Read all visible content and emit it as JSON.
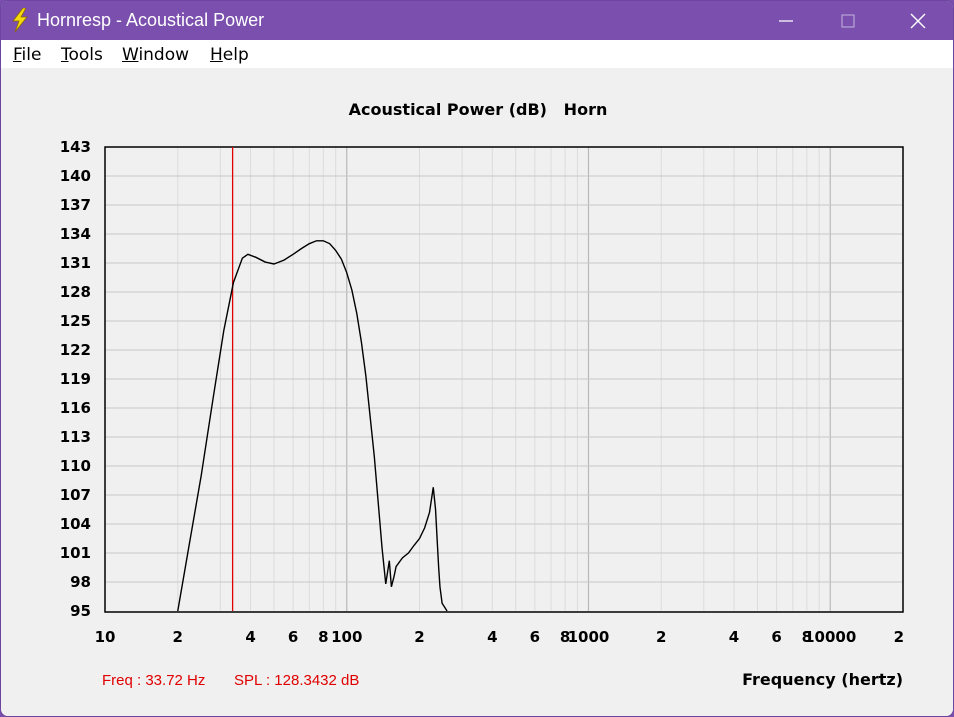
{
  "window": {
    "title": "Hornresp - Acoustical Power",
    "icon": "lightning-bolt-icon"
  },
  "menu": [
    {
      "mnemonic": "F",
      "rest": "ile"
    },
    {
      "mnemonic": "T",
      "rest": "ools"
    },
    {
      "mnemonic": "W",
      "rest": "indow"
    },
    {
      "mnemonic": "H",
      "rest": "elp"
    }
  ],
  "cursor_readout": {
    "freq": "Freq : 33.72 Hz",
    "spl": "SPL : 128.3432 dB",
    "cursor_hz": 33.72
  },
  "colors": {
    "titlebar": "#7a4fad",
    "curve": "#000000",
    "cursor": "#e00000",
    "grid": "#c8c8c8",
    "readout": "#e00000"
  },
  "chart_data": {
    "type": "line",
    "title": "Acoustical Power (dB)   Horn",
    "xlabel": "Frequency (hertz)",
    "ylabel": "",
    "x_scale": "log",
    "xlim": [
      10,
      20000
    ],
    "ylim": [
      95,
      143
    ],
    "y_ticks": [
      143,
      140,
      137,
      134,
      131,
      128,
      125,
      122,
      119,
      116,
      113,
      110,
      107,
      104,
      101,
      98,
      95
    ],
    "x_ticks": [
      {
        "v": 10,
        "label": "10"
      },
      {
        "v": 20,
        "label": "2"
      },
      {
        "v": 40,
        "label": "4"
      },
      {
        "v": 60,
        "label": "6"
      },
      {
        "v": 80,
        "label": "8"
      },
      {
        "v": 100,
        "label": "100"
      },
      {
        "v": 200,
        "label": "2"
      },
      {
        "v": 400,
        "label": "4"
      },
      {
        "v": 600,
        "label": "6"
      },
      {
        "v": 800,
        "label": "8"
      },
      {
        "v": 1000,
        "label": "1000"
      },
      {
        "v": 2000,
        "label": "2"
      },
      {
        "v": 4000,
        "label": "4"
      },
      {
        "v": 6000,
        "label": "6"
      },
      {
        "v": 8000,
        "label": "8"
      },
      {
        "v": 10000,
        "label": "10000"
      },
      {
        "v": 20000,
        "label": "2"
      }
    ],
    "grid": true,
    "series": [
      {
        "x": [
          20,
          22,
          25,
          28,
          31,
          34,
          37,
          39,
          42,
          46,
          50,
          55,
          60,
          65,
          70,
          75,
          80,
          85,
          90,
          95,
          100,
          105,
          110,
          115,
          120,
          130,
          140,
          145,
          150,
          153,
          157,
          160,
          170,
          180,
          190,
          200,
          210,
          220,
          228,
          233,
          237,
          240,
          243,
          248,
          260
        ],
        "y": [
          95,
          101,
          109,
          117,
          124,
          129,
          131.5,
          131.9,
          131.6,
          131.1,
          130.9,
          131.3,
          131.9,
          132.5,
          133.0,
          133.3,
          133.3,
          133.0,
          132.3,
          131.4,
          130.0,
          128.2,
          125.8,
          122.8,
          119.3,
          111.0,
          101.5,
          97.8,
          100.2,
          97.5,
          98.6,
          99.6,
          100.5,
          101.0,
          101.8,
          102.5,
          103.6,
          105.2,
          107.8,
          105.5,
          102.0,
          99.5,
          97.5,
          95.8,
          95
        ]
      }
    ]
  }
}
